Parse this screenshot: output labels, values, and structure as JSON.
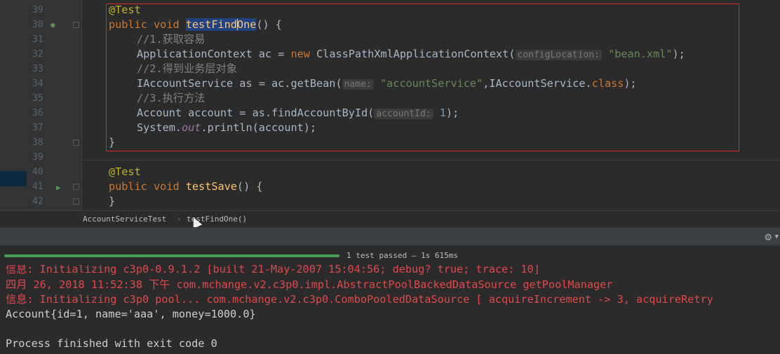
{
  "editor": {
    "line_numbers": [
      "39",
      "30",
      "31",
      "32",
      "33",
      "34",
      "35",
      "36",
      "37",
      "38",
      "39",
      "40",
      "41",
      "42"
    ],
    "code": {
      "l1_ann": "@Test",
      "l2_kw1": "public",
      "l2_kw2": "void",
      "l2_fn_a": "testFind",
      "l2_fn_b": "One",
      "l2_rest": "() {",
      "l3_comment": "//1.获取容易",
      "l4_a": "ApplicationContext ac = ",
      "l4_new": "new",
      "l4_b": " ClassPathXmlApplicationContext(",
      "l4_hint": "configLocation:",
      "l4_str": "\"bean.xml\"",
      "l4_c": ");",
      "l5_comment": "//2.得到业务层对象",
      "l6_a": "IAccountService as = ac.getBean(",
      "l6_hint": "name:",
      "l6_str": "\"accountService\"",
      "l6_b": ",IAccountService.",
      "l6_kw": "class",
      "l6_c": ");",
      "l7_comment": "//3.执行方法",
      "l8_a": "Account account = as.findAccountById(",
      "l8_hint": "accountId:",
      "l8_num": "1",
      "l8_b": ");",
      "l9_a": "System.",
      "l9_fld": "out",
      "l9_b": ".println(account);",
      "l10": "}",
      "l12_ann": "@Test",
      "l13_kw1": "public",
      "l13_kw2": "void",
      "l13_fn": "testSave",
      "l13_rest": "() {",
      "l14": "}"
    }
  },
  "breadcrumb": {
    "class_name": "AccountServiceTest",
    "separator": "›",
    "method": "testFindOne()"
  },
  "run": {
    "status": "1 test passed – 1s 615ms",
    "progress_fraction": 0.43
  },
  "console": {
    "line1": "信息: Initializing c3p0-0.9.1.2 [built 21-May-2007 15:04:56; debug? true; trace: 10]",
    "line2": "四月 26, 2018 11:52:38 下午 com.mchange.v2.c3p0.impl.AbstractPoolBackedDataSource getPoolManager",
    "line3": "信息: Initializing c3p0 pool... com.mchange.v2.c3p0.ComboPooledDataSource [ acquireIncrement -> 3, acquireRetry",
    "line4": "Account{id=1, name='aaa', money=1000.0}",
    "line5": "",
    "line6": "Process finished with exit code 0"
  },
  "icons": {
    "gear": "gear-icon",
    "run": "run-test-icon"
  },
  "colors": {
    "progress": "#499c54",
    "error_text": "#e1484b",
    "highlight_box": "#d9262b"
  }
}
